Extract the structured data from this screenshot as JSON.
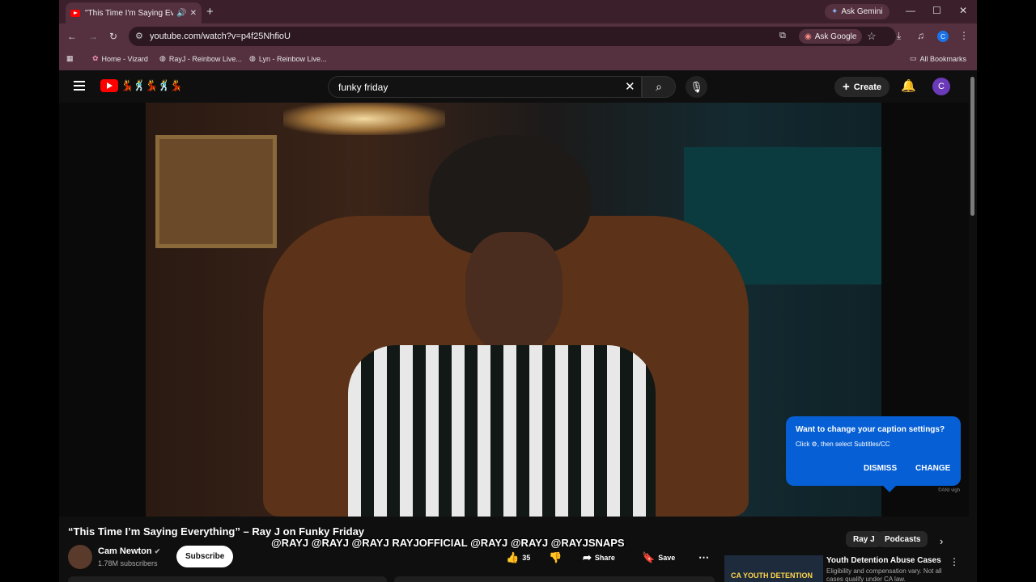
{
  "browser": {
    "tab_title": "\"This Time I'm Saying Every",
    "new_tab": "+",
    "ask_gemini": "Ask Gemini",
    "url": "youtube.com/watch?v=p4f25NhfioU",
    "ask_google": "Ask Google",
    "profile_initial": "C",
    "bookmarks": [
      "Home - Vizard",
      "RayJ - Reinbow Live...",
      "Lyn - Reinbow Live..."
    ],
    "all_bookmarks": "All Bookmarks"
  },
  "youtube": {
    "search_value": "funky friday",
    "create_label": "Create",
    "avatar_initial": "C"
  },
  "caption_tip": {
    "heading": "Want to change your caption settings?",
    "body": "Click ⚙, then select Subtitles/CC",
    "dismiss": "DISMISS",
    "change": "CHANGE"
  },
  "video": {
    "title": "“This Time I’m Saying Everything” – Ray J on Funky Friday",
    "channel": "Cam Newton",
    "subscribers": "1.78M subscribers",
    "subscribe": "Subscribe",
    "overlay_text": "@RAYJ  @RAYJ  @RAYJ  RAYJOFFICIAL  @RAYJ  @RAYJ  @RAYJSNAPS",
    "likes": "35",
    "share": "Share",
    "save": "Save",
    "watermark": "©ANI vlgh"
  },
  "chips": [
    "Ray J",
    "Podcasts"
  ],
  "recommendation": {
    "thumb_text": "CA YOUTH DETENTION",
    "title": "Youth Detention Abuse Cases",
    "desc": "Eligibility and compensation vary. Not all cases qualify under CA law."
  }
}
